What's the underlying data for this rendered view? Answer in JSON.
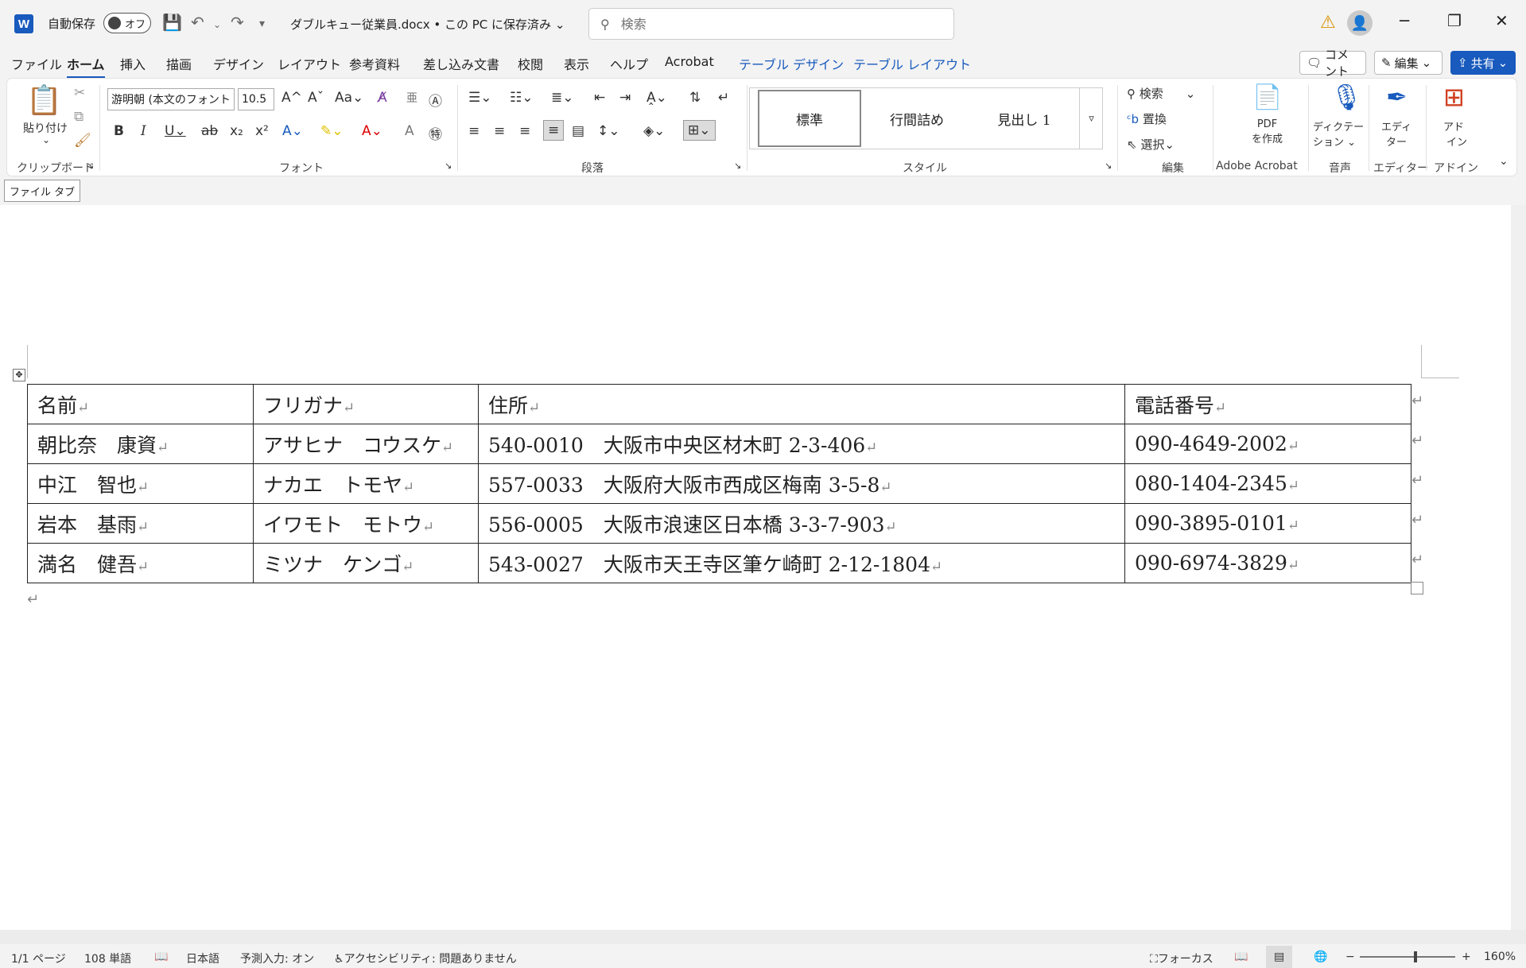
{
  "titlebar": {
    "logo": "W",
    "autosave_label": "自動保存",
    "autosave_state": "オフ",
    "doc_title": "ダブルキュー従業員.docx • この PC に保存済み",
    "search_placeholder": "検索",
    "minimize": "─",
    "restore": "❐",
    "close": "✕"
  },
  "tabs": [
    "ファイル",
    "ホーム",
    "挿入",
    "描画",
    "デザイン",
    "レイアウト",
    "参考資料",
    "差し込み文書",
    "校閲",
    "表示",
    "ヘルプ",
    "Acrobat",
    "テーブル デザイン",
    "テーブル レイアウト"
  ],
  "active_tab": "ホーム",
  "right_buttons": {
    "comment": "コメント",
    "edit": "編集",
    "share": "共有"
  },
  "ribbon": {
    "clipboard": {
      "label": "クリップボード",
      "paste": "貼り付け"
    },
    "font": {
      "label": "フォント",
      "font_name": "游明朝 (本文のフォント",
      "font_size": "10.5"
    },
    "paragraph": {
      "label": "段落"
    },
    "styles": {
      "label": "スタイル",
      "items": [
        "標準",
        "行間詰め",
        "見出し 1"
      ]
    },
    "editing": {
      "label": "編集",
      "find": "検索",
      "replace": "置換",
      "select": "選択"
    },
    "acrobat": {
      "label": "Adobe Acrobat",
      "pdf_line1": "PDF",
      "pdf_line2": "を作成"
    },
    "voice": {
      "label": "音声",
      "dictate_line1": "ディクテー",
      "dictate_line2": "ション"
    },
    "editor": {
      "label": "エディター",
      "line1": "エディ",
      "line2": "ター"
    },
    "addins": {
      "label": "アドイン",
      "line1": "アド",
      "line2": "イン"
    }
  },
  "tooltip": "ファイル タブ",
  "table": {
    "header": [
      "名前",
      "フリガナ",
      "住所",
      "電話番号"
    ],
    "rows": [
      [
        "朝比奈　康資",
        "アサヒナ　コウスケ",
        "540-0010　大阪市中央区材木町 2-3-406",
        "090-4649-2002"
      ],
      [
        "中江　智也",
        "ナカエ　トモヤ",
        "557-0033　大阪府大阪市西成区梅南 3-5-8",
        "080-1404-2345"
      ],
      [
        "岩本　基雨",
        "イワモト　モトウ",
        "556-0005　大阪市浪速区日本橋 3-3-7-903",
        "090-3895-0101"
      ],
      [
        "満名　健吾",
        "ミツナ　ケンゴ",
        "543-0027　大阪市天王寺区筆ケ崎町 2-12-1804",
        "090-6974-3829"
      ]
    ]
  },
  "paragraph_mark": "↵",
  "statusbar": {
    "page": "1/1 ページ",
    "words": "108 単語",
    "language": "日本語",
    "predict": "予測入力: オン",
    "accessibility": "アクセシビリティ: 問題ありません",
    "focus": "フォーカス",
    "zoom_minus": "−",
    "zoom_plus": "+",
    "zoom": "160%"
  }
}
